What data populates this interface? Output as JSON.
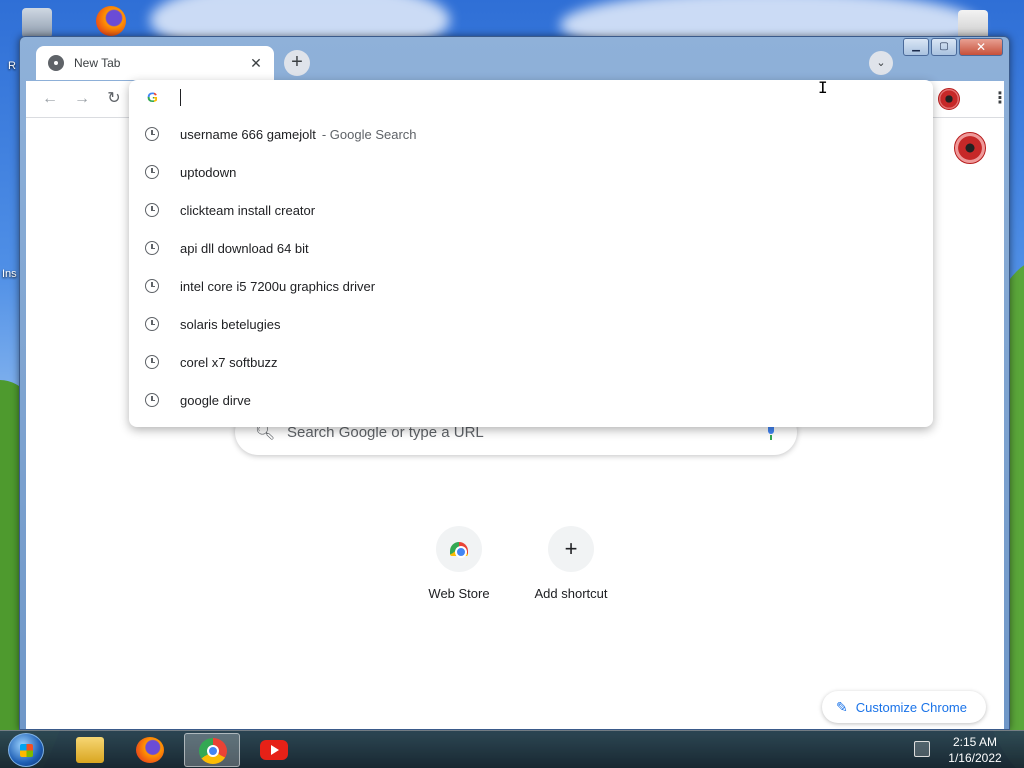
{
  "desktop": {
    "labels": [
      "R",
      "Ins"
    ]
  },
  "browser": {
    "tab": {
      "title": "New Tab",
      "close_glyph": "✕"
    },
    "new_tab_glyph": "+",
    "tab_search_glyph": "⌄",
    "window_controls": {
      "minimize": "▁",
      "maximize": "▢",
      "close": "✕"
    },
    "toolbar": {
      "back_glyph": "←",
      "forward_glyph": "→",
      "reload_glyph": "↻",
      "menu_glyph": "⋮"
    },
    "omnibox": {
      "value": "",
      "suggestions": [
        {
          "text": "username 666 gamejolt",
          "desc": "- Google Search"
        },
        {
          "text": "uptodown",
          "desc": ""
        },
        {
          "text": "clickteam install creator",
          "desc": ""
        },
        {
          "text": "api dll download 64 bit",
          "desc": ""
        },
        {
          "text": "intel core i5 7200u graphics driver",
          "desc": ""
        },
        {
          "text": "solaris betelugies",
          "desc": ""
        },
        {
          "text": "corel x7 softbuzz",
          "desc": ""
        },
        {
          "text": "google dirve",
          "desc": ""
        }
      ]
    },
    "ntp": {
      "search_placeholder": "Search Google or type a URL",
      "shortcuts": [
        {
          "label": "Web Store"
        },
        {
          "label": "Add shortcut",
          "glyph": "+"
        }
      ],
      "customize_label": "Customize Chrome",
      "customize_glyph": "✎"
    }
  },
  "taskbar": {
    "time": "2:15 AM",
    "date": "1/16/2022"
  },
  "colors": {
    "accent": "#1a73e8",
    "text": "#202124",
    "secondary_text": "#5f6368"
  }
}
